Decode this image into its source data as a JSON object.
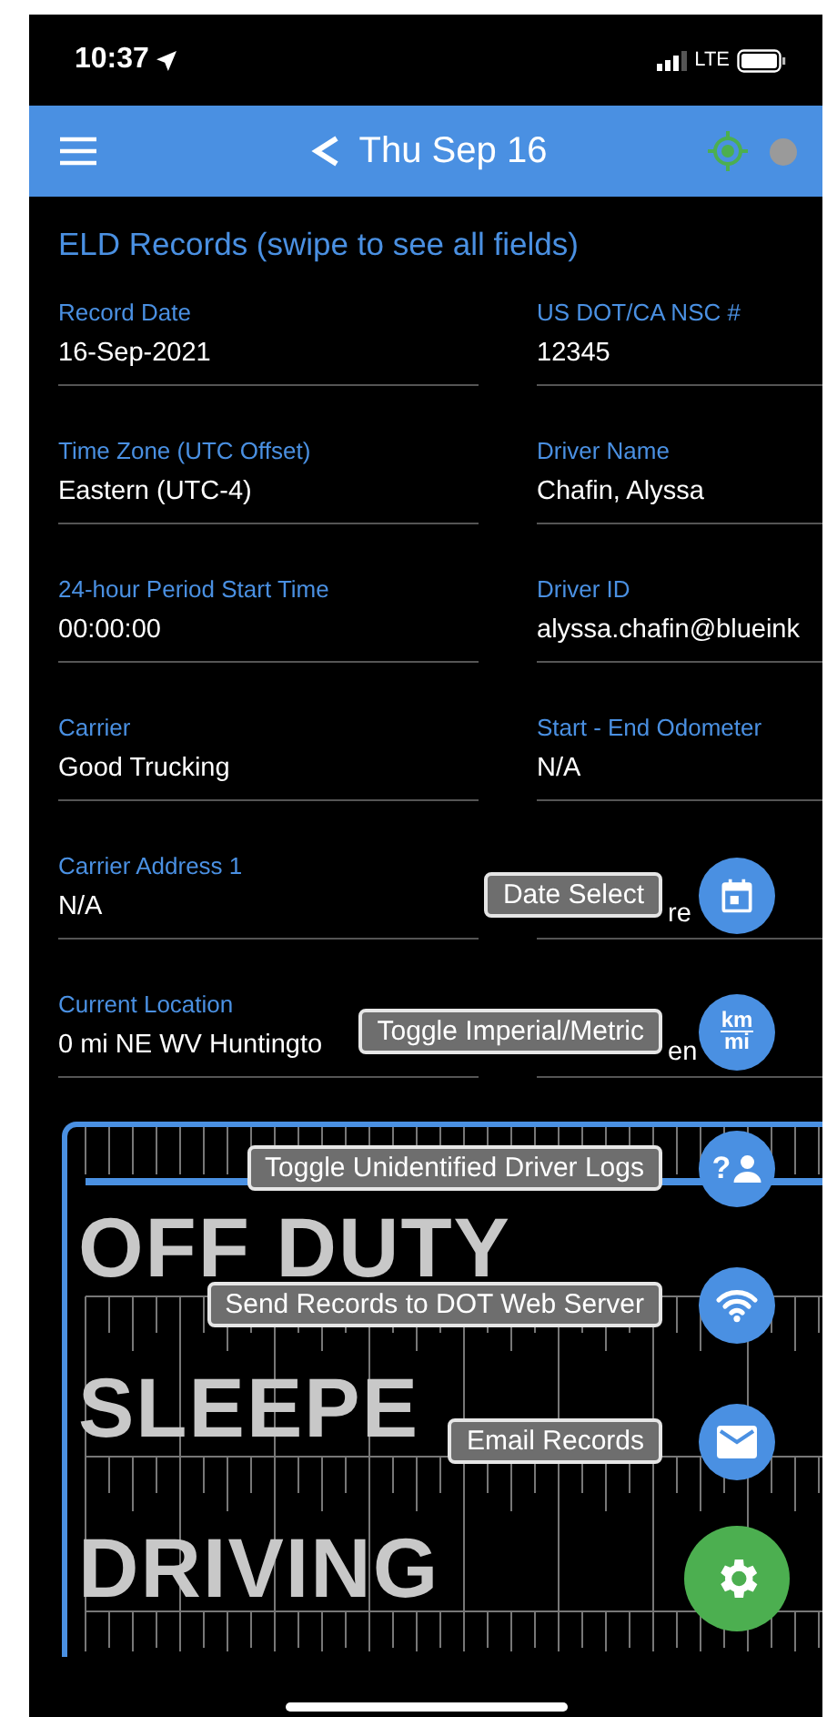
{
  "status_bar": {
    "time": "10:37",
    "network": "LTE"
  },
  "header": {
    "title": "Thu Sep 16"
  },
  "section_title": "ELD Records (swipe to see all fields)",
  "fields": [
    {
      "kind": "field",
      "label": "Record Date",
      "value": "16-Sep-2021"
    },
    {
      "kind": "field",
      "label": "US DOT/CA NSC #",
      "value": "12345"
    },
    {
      "kind": "field",
      "label": "Time Zone (UTC Offset)",
      "value": "Eastern (UTC-4)"
    },
    {
      "kind": "field",
      "label": "Driver Name",
      "value": "Chafin, Alyssa"
    },
    {
      "kind": "field",
      "label": "24-hour Period Start Time",
      "value": "00:00:00"
    },
    {
      "kind": "field",
      "label": "Driver ID",
      "value": "alyssa.chafin@blueink"
    },
    {
      "kind": "field",
      "label": "Carrier",
      "value": "Good Trucking"
    },
    {
      "kind": "field",
      "label": "Start - End Odometer",
      "value": "N/A"
    },
    {
      "kind": "field",
      "label": "Carrier Address 1",
      "value": "N/A"
    },
    {
      "kind": "fragment",
      "value": "re"
    },
    {
      "kind": "field",
      "label": "Current Location",
      "value": "0 mi NE WV Huntingto"
    },
    {
      "kind": "fragment",
      "value": "en"
    }
  ],
  "log_chart": {
    "statuses": [
      "OFF DUTY",
      "SLEEPE",
      "DRIVING"
    ]
  },
  "action_menu": [
    {
      "kind": "calendar",
      "label": "Date Select"
    },
    {
      "kind": "units",
      "label": "Toggle Imperial/Metric",
      "icon_top": "km",
      "icon_bottom": "mi"
    },
    {
      "kind": "unidentified",
      "label": "Toggle Unidentified Driver Logs",
      "icon_mark": "?"
    },
    {
      "kind": "wifi",
      "label": "Send Records to DOT Web Server"
    },
    {
      "kind": "email",
      "label": "Email Records"
    }
  ]
}
